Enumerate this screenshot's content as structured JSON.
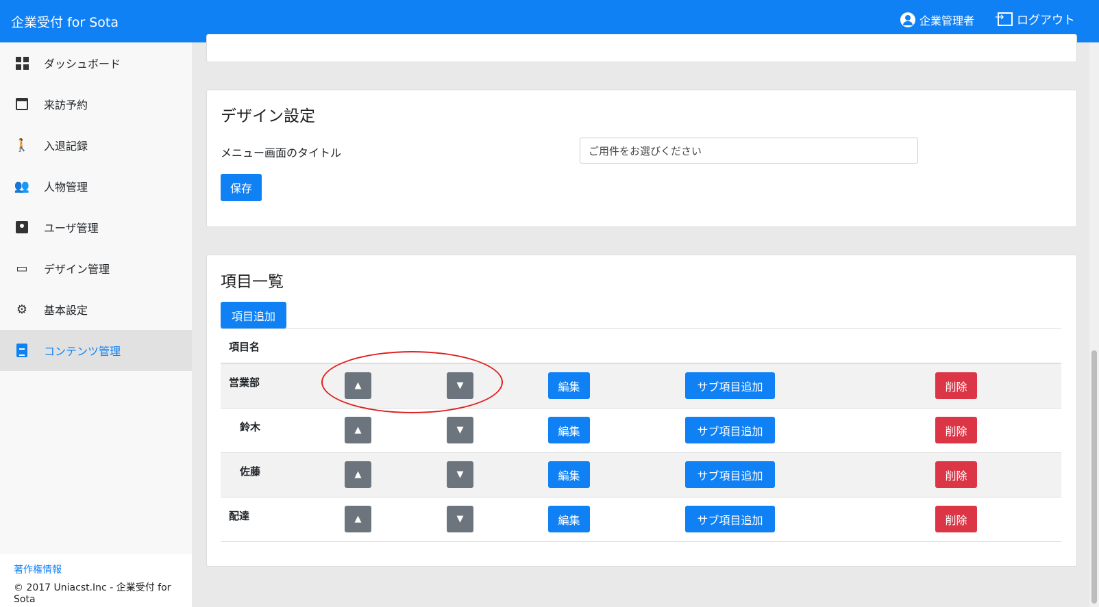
{
  "header": {
    "brand": "企業受付 for Sota",
    "user_label": "企業管理者",
    "logout_label": "ログアウト"
  },
  "sidebar": {
    "items": [
      {
        "label": "ダッシュボード",
        "icon": "dashboard-icon"
      },
      {
        "label": "来訪予約",
        "icon": "calendar-icon"
      },
      {
        "label": "入退記録",
        "icon": "walking-icon"
      },
      {
        "label": "人物管理",
        "icon": "people-icon"
      },
      {
        "label": "ユーザ管理",
        "icon": "account-box-icon"
      },
      {
        "label": "デザイン管理",
        "icon": "devices-icon"
      },
      {
        "label": "基本設定",
        "icon": "gear-icon"
      },
      {
        "label": "コンテンツ管理",
        "icon": "clipboard-icon",
        "active": true
      }
    ],
    "footer": {
      "link": "著作権情報",
      "copyright": "© 2017 Uniacst.Inc - 企業受付 for Sota"
    }
  },
  "design_settings": {
    "title": "デザイン設定",
    "menu_title_label": "メニュー画面のタイトル",
    "menu_title_value": "ご用件をお選びください",
    "save_label": "保存"
  },
  "item_list": {
    "title": "項目一覧",
    "add_label": "項目追加",
    "column_name": "項目名",
    "up_label": "▲",
    "down_label": "▼",
    "edit_label": "編集",
    "add_sub_label": "サブ項目追加",
    "delete_label": "削除",
    "rows": [
      {
        "name": "営業部",
        "sub": false
      },
      {
        "name": "鈴木",
        "sub": true
      },
      {
        "name": "佐藤",
        "sub": true
      },
      {
        "name": "配達",
        "sub": false
      }
    ]
  },
  "colors": {
    "primary": "#1081f5",
    "danger": "#dc3545",
    "secondary": "#6c757d",
    "annotation": "#e02020"
  }
}
